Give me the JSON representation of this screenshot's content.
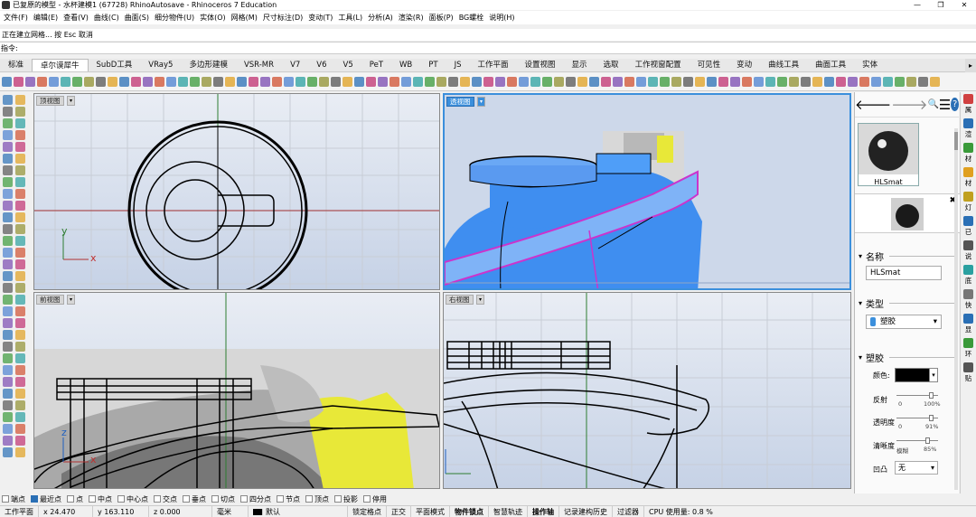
{
  "window": {
    "title": "已复原的模型 - 水杯建模1 (67728) RhinoAutosave - Rhinoceros 7 Education",
    "controls": [
      "—",
      "❐",
      "✕"
    ]
  },
  "menu": [
    "文件(F)",
    "编辑(E)",
    "查看(V)",
    "曲线(C)",
    "曲面(S)",
    "细分物件(U)",
    "实体(O)",
    "网格(M)",
    "尺寸标注(D)",
    "变动(T)",
    "工具(L)",
    "分析(A)",
    "渲染(R)",
    "面板(P)",
    "BG螺栓",
    "说明(H)"
  ],
  "command": {
    "history": "正在建立网格... 按 Esc 取消",
    "prompt": "指令:",
    "value": ""
  },
  "tabs": [
    "标准",
    "卓尔谟犀牛",
    "SubD工具",
    "VRay5",
    "多边形建模",
    "VSR-MR",
    "V7",
    "V6",
    "V5",
    "PeT",
    "WB",
    "PT",
    "JS",
    "工作平面",
    "设置视图",
    "显示",
    "选取",
    "工作视窗配置",
    "可见性",
    "变动",
    "曲线工具",
    "曲面工具",
    "实体"
  ],
  "active_tab": "卓尔谟犀牛",
  "tab_nav": "▸",
  "viewports": {
    "top": {
      "label": "顶视图"
    },
    "perspective": {
      "label": "透视图"
    },
    "front": {
      "label": "前视图"
    },
    "right": {
      "label": "右视图"
    },
    "axis_x": "x",
    "axis_y": "y",
    "axis_z": "z",
    "dropdown": "▾"
  },
  "right_panel": {
    "nav": {
      "back": "🡐",
      "forward": "🡒",
      "search": "🔍",
      "menu": "☰",
      "help": "?"
    },
    "material_name": "HLSmat",
    "close": "✖",
    "name_section": "名称",
    "name_value": "HLSmat",
    "type_section": "类型",
    "type_value": "塑胶",
    "plastic_section": "塑胶",
    "color_label": "颜色:",
    "color_value": "#000000",
    "reflect_label": "反射",
    "reflect_min": "0",
    "reflect_max": "100%",
    "transparency_label": "透明度",
    "transparency_min": "0",
    "transparency_max": "91%",
    "clarity_label": "清晰度",
    "clarity_min": "模糊",
    "clarity_max": "85%",
    "bump_label": "凹凸",
    "bump_value": "无",
    "caret": "▾"
  },
  "right_bar": [
    "属",
    "渲",
    "材",
    "材",
    "灯",
    "已",
    "说",
    "底",
    "快",
    "显",
    "环",
    "贴"
  ],
  "osnap": [
    {
      "label": "端点",
      "checked": false
    },
    {
      "label": "最近点",
      "checked": true
    },
    {
      "label": "点",
      "checked": false
    },
    {
      "label": "中点",
      "checked": false
    },
    {
      "label": "中心点",
      "checked": false
    },
    {
      "label": "交点",
      "checked": false
    },
    {
      "label": "垂点",
      "checked": false
    },
    {
      "label": "切点",
      "checked": false
    },
    {
      "label": "四分点",
      "checked": false
    },
    {
      "label": "节点",
      "checked": false
    },
    {
      "label": "顶点",
      "checked": false
    },
    {
      "label": "投影",
      "checked": false
    },
    {
      "label": "停用",
      "checked": false
    }
  ],
  "status": {
    "plane": "工作平面",
    "x": "x 24.470",
    "y": "y 163.110",
    "z": "z 0.000",
    "unit": "毫米",
    "layer": "默认",
    "items": [
      "锁定格点",
      "正交",
      "平面模式",
      "物件锁点",
      "智慧轨迹",
      "操作轴",
      "记录建构历史",
      "过滤器"
    ],
    "bold_items": [
      "物件锁点",
      "操作轴"
    ],
    "cpu": "CPU 使用量: 0.8 %"
  },
  "colors": {
    "viewport_top": "#e9edf4",
    "viewport_bottom": "#c6d2e6",
    "active_label": "#3b8fdc",
    "mesh_blue": "#3f8ef0",
    "highlight_magenta": "#cc33cc",
    "yellow": "#e8e838"
  }
}
